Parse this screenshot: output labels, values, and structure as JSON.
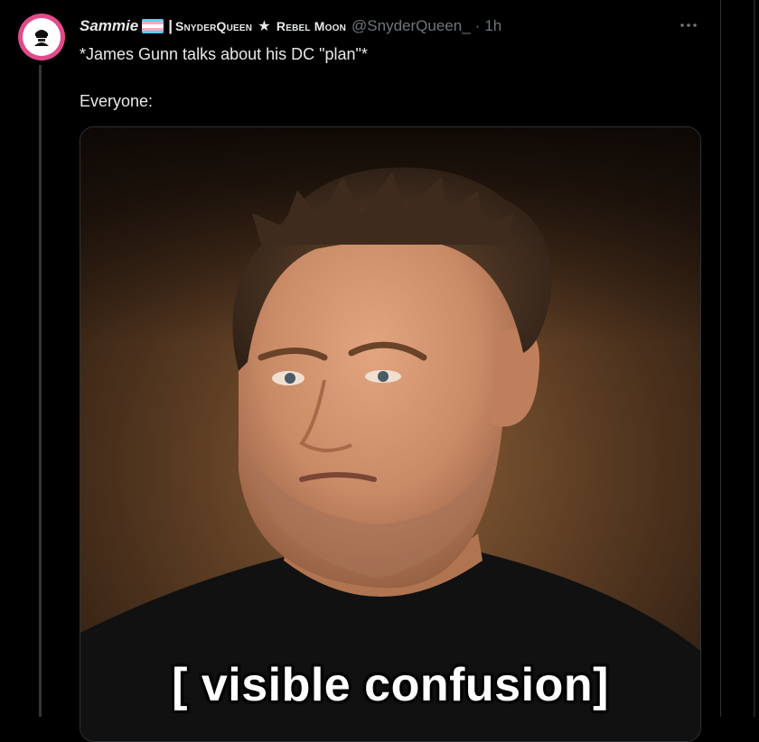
{
  "tweet": {
    "display_name": "Sammie",
    "name_suffix_sep": "|",
    "name_suffix_part1": "SnyderQueen",
    "name_suffix_star": "★",
    "name_suffix_part2": "Rebel Moon",
    "handle": "@SnyderQueen_",
    "dot": "·",
    "timestamp": "1h",
    "text_line1": "*James Gunn talks about his DC \"plan\"*",
    "text_line2": "Everyone:",
    "media": {
      "caption": "[ visible confusion]"
    }
  },
  "icons": {
    "avatar": "profile-avatar-icon",
    "flag": "transgender-flag-icon",
    "more": "more-options-icon"
  },
  "colors": {
    "background": "#000000",
    "text_primary": "#e7e9ea",
    "text_secondary": "#71767b",
    "border": "#2f3336",
    "avatar_ring": "#e24a8a",
    "flag_blue": "#5bcefa",
    "flag_pink": "#f5a9b8",
    "flag_white": "#ffffff"
  }
}
